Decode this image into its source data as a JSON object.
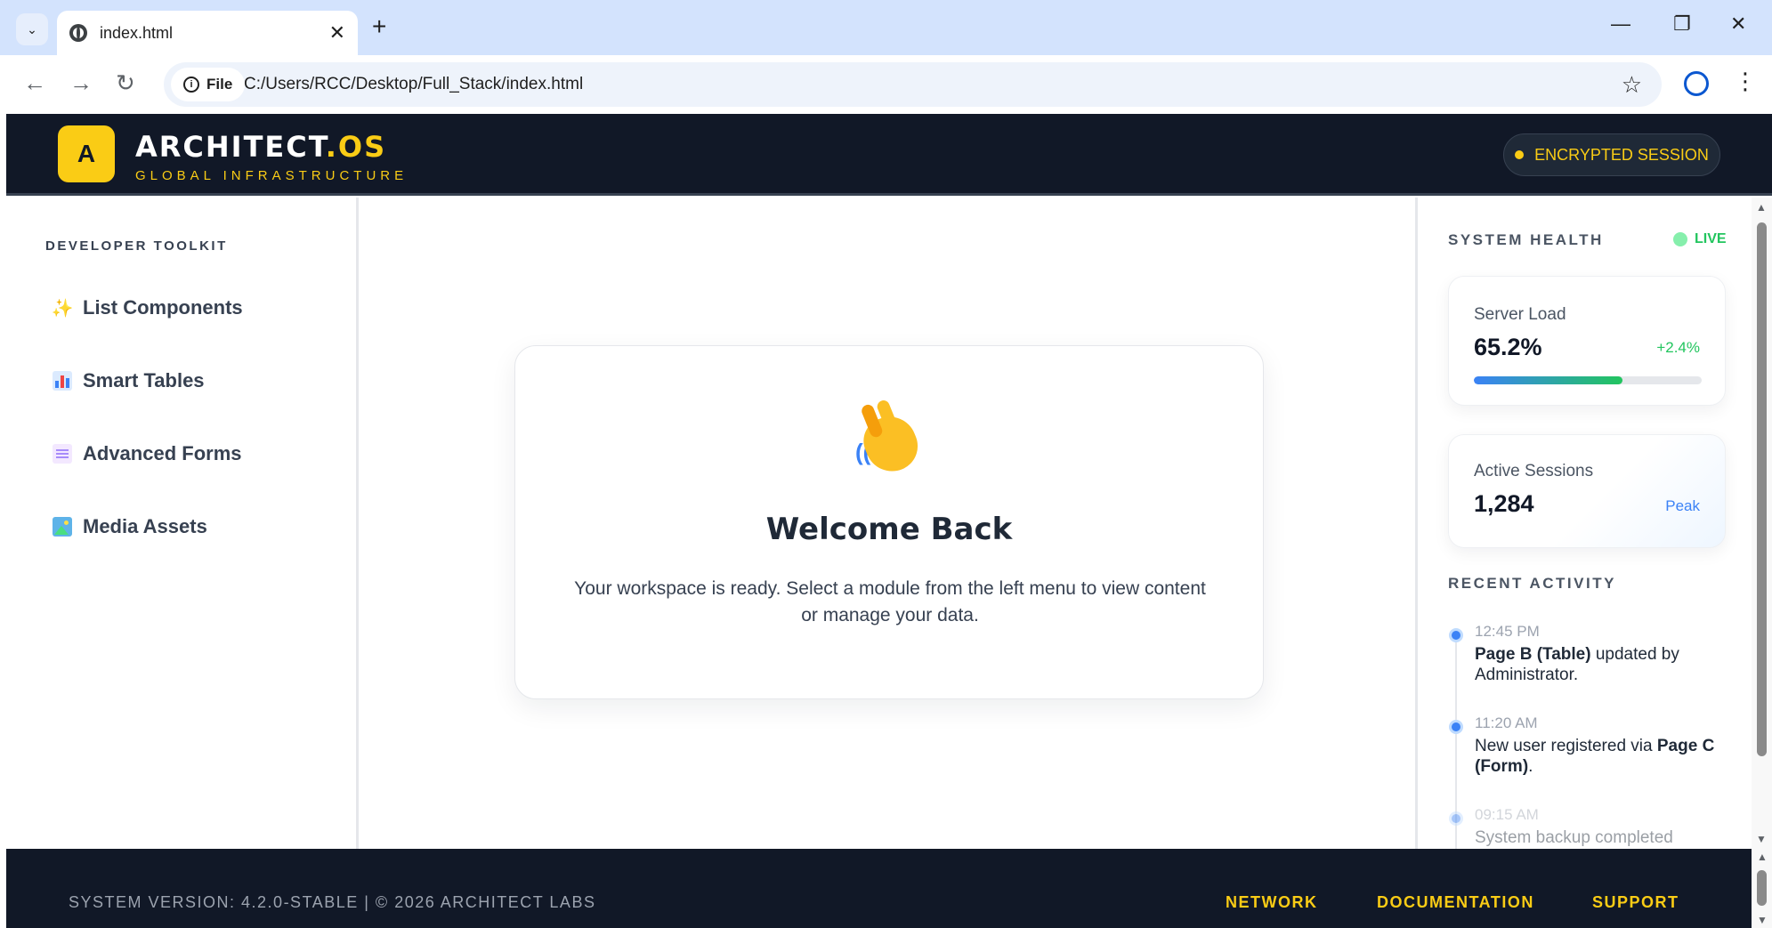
{
  "browser": {
    "tab_title": "index.html",
    "file_label": "File",
    "url": "C:/Users/RCC/Desktop/Full_Stack/index.html"
  },
  "header": {
    "logo_letter": "A",
    "brand_main": "ARCHITECT",
    "brand_accent": ".OS",
    "brand_sub": "GLOBAL INFRASTRUCTURE",
    "session_label": "ENCRYPTED SESSION"
  },
  "sidebar": {
    "heading": "DEVELOPER TOOLKIT",
    "items": [
      {
        "icon": "sparkles-icon",
        "label": "List Components"
      },
      {
        "icon": "bar-chart-icon",
        "label": "Smart Tables"
      },
      {
        "icon": "document-icon",
        "label": "Advanced Forms"
      },
      {
        "icon": "image-icon",
        "label": "Media Assets"
      }
    ]
  },
  "main": {
    "welcome_icon": "waving-hand-icon",
    "welcome_title": "Welcome Back",
    "welcome_text": "Your workspace is ready. Select a module from the left menu to view content or manage your data."
  },
  "right_panel": {
    "health_heading": "SYSTEM HEALTH",
    "live_label": "LIVE",
    "server_load": {
      "label": "Server Load",
      "value": "65.2%",
      "delta": "+2.4%",
      "progress_percent": 65.2
    },
    "active_sessions": {
      "label": "Active Sessions",
      "value": "1,284",
      "note": "Peak"
    },
    "activity_heading": "RECENT ACTIVITY",
    "activity": [
      {
        "time": "12:45 PM",
        "bold": "Page B (Table)",
        "text_after": " updated by Administrator."
      },
      {
        "time": "11:20 AM",
        "text_before": "New user registered via ",
        "bold": "Page C (Form)",
        "text_after": "."
      },
      {
        "time": "09:15 AM",
        "text": "System backup completed"
      }
    ]
  },
  "footer": {
    "version_text": "SYSTEM VERSION: 4.2.0-STABLE | © 2026 ARCHITECT LABS",
    "links": [
      "NETWORK",
      "DOCUMENTATION",
      "SUPPORT"
    ]
  },
  "colors": {
    "header_bg": "#111827",
    "accent_yellow": "#facc15",
    "live_green": "#22c55e",
    "timeline_blue": "#3b82f6"
  }
}
